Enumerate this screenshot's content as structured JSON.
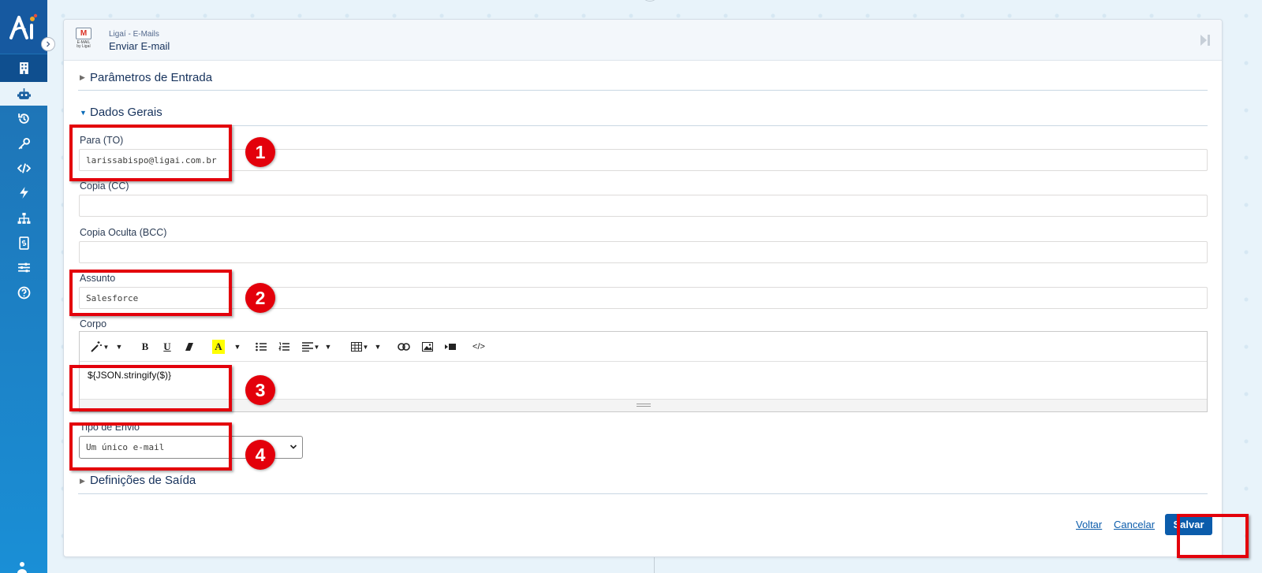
{
  "header": {
    "app_caption": "E-MAIL by Ligaí",
    "subtitle": "Ligaí - E-Mails",
    "title": "Enviar E-mail"
  },
  "sections": {
    "input_params": "Parâmetros de Entrada",
    "general_data": "Dados Gerais",
    "output_defs": "Definições de Saída"
  },
  "fields": {
    "to_label": "Para (TO)",
    "to_value": "larissabispo@ligai.com.br",
    "cc_label": "Copia (CC)",
    "cc_value": "",
    "bcc_label": "Copia Oculta (BCC)",
    "bcc_value": "",
    "subject_label": "Assunto",
    "subject_value": "Salesforce",
    "body_label": "Corpo",
    "body_value": "${JSON.stringify($)}",
    "send_type_label": "Tipo de Envio",
    "send_type_value": "Um único e-mail"
  },
  "toolbar": {
    "bold": "B",
    "underline": "U",
    "highlight": "A",
    "code": "</>"
  },
  "actions": {
    "back": "Voltar",
    "cancel": "Cancelar",
    "save": "Salvar"
  },
  "markers": [
    "1",
    "2",
    "3",
    "4"
  ],
  "colors": {
    "sidebar": "#1a8fd6",
    "annotation": "#e3000b",
    "primary_button": "#0b5cab"
  }
}
